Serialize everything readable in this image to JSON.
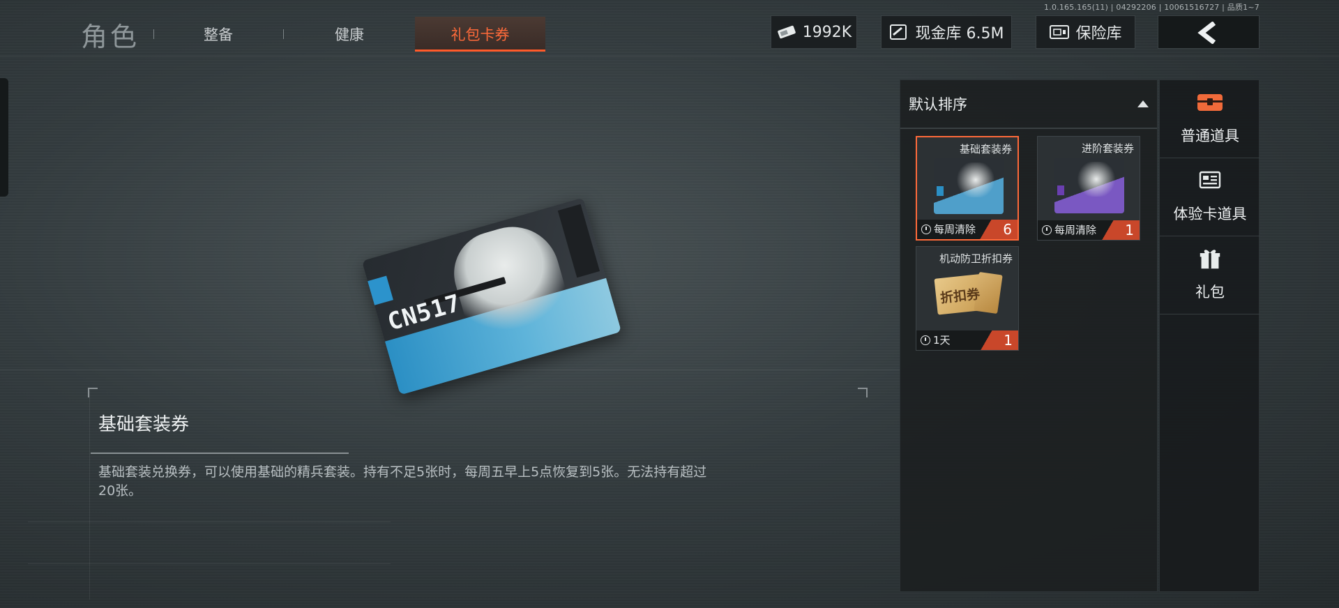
{
  "version_text": "1.0.165.165(11) | 04292206 | 10061516727 | 品质1~7",
  "header": {
    "title": "角色",
    "tabs": [
      {
        "label": "整备"
      },
      {
        "label": "健康"
      },
      {
        "label": "礼包卡券",
        "active": true
      }
    ]
  },
  "resources": {
    "tickets": "1992K",
    "cash_vault": "现金库 6.5M",
    "safe": "保险库"
  },
  "preview_card": {
    "code": "CN517"
  },
  "selected_item": {
    "title": "基础套装券",
    "description": "基础套装兑换券，可以使用基础的精兵套装。持有不足5张时，每周五早上5点恢复到5张。无法持有超过20张。"
  },
  "inventory": {
    "sort_label": "默认排序",
    "items": [
      {
        "name": "基础套装券",
        "timer": "每周清除",
        "count": "6",
        "selected": true,
        "accent": "#2b8fc4"
      },
      {
        "name": "进阶套装券",
        "timer": "每周清除",
        "count": "1",
        "selected": false,
        "accent": "#6a3fb0"
      },
      {
        "name": "机动防卫折扣券",
        "timer": "1天",
        "count": "1",
        "selected": false,
        "accent": "#c9a25a",
        "thumb_text": "折扣券"
      }
    ]
  },
  "categories": [
    {
      "label": "普通道具",
      "icon": "chest-icon"
    },
    {
      "label": "体验卡道具",
      "icon": "card-icon"
    },
    {
      "label": "礼包",
      "icon": "gift-icon"
    }
  ],
  "colors": {
    "accent": "#ff6a3a",
    "count_badge": "#c9472a"
  }
}
